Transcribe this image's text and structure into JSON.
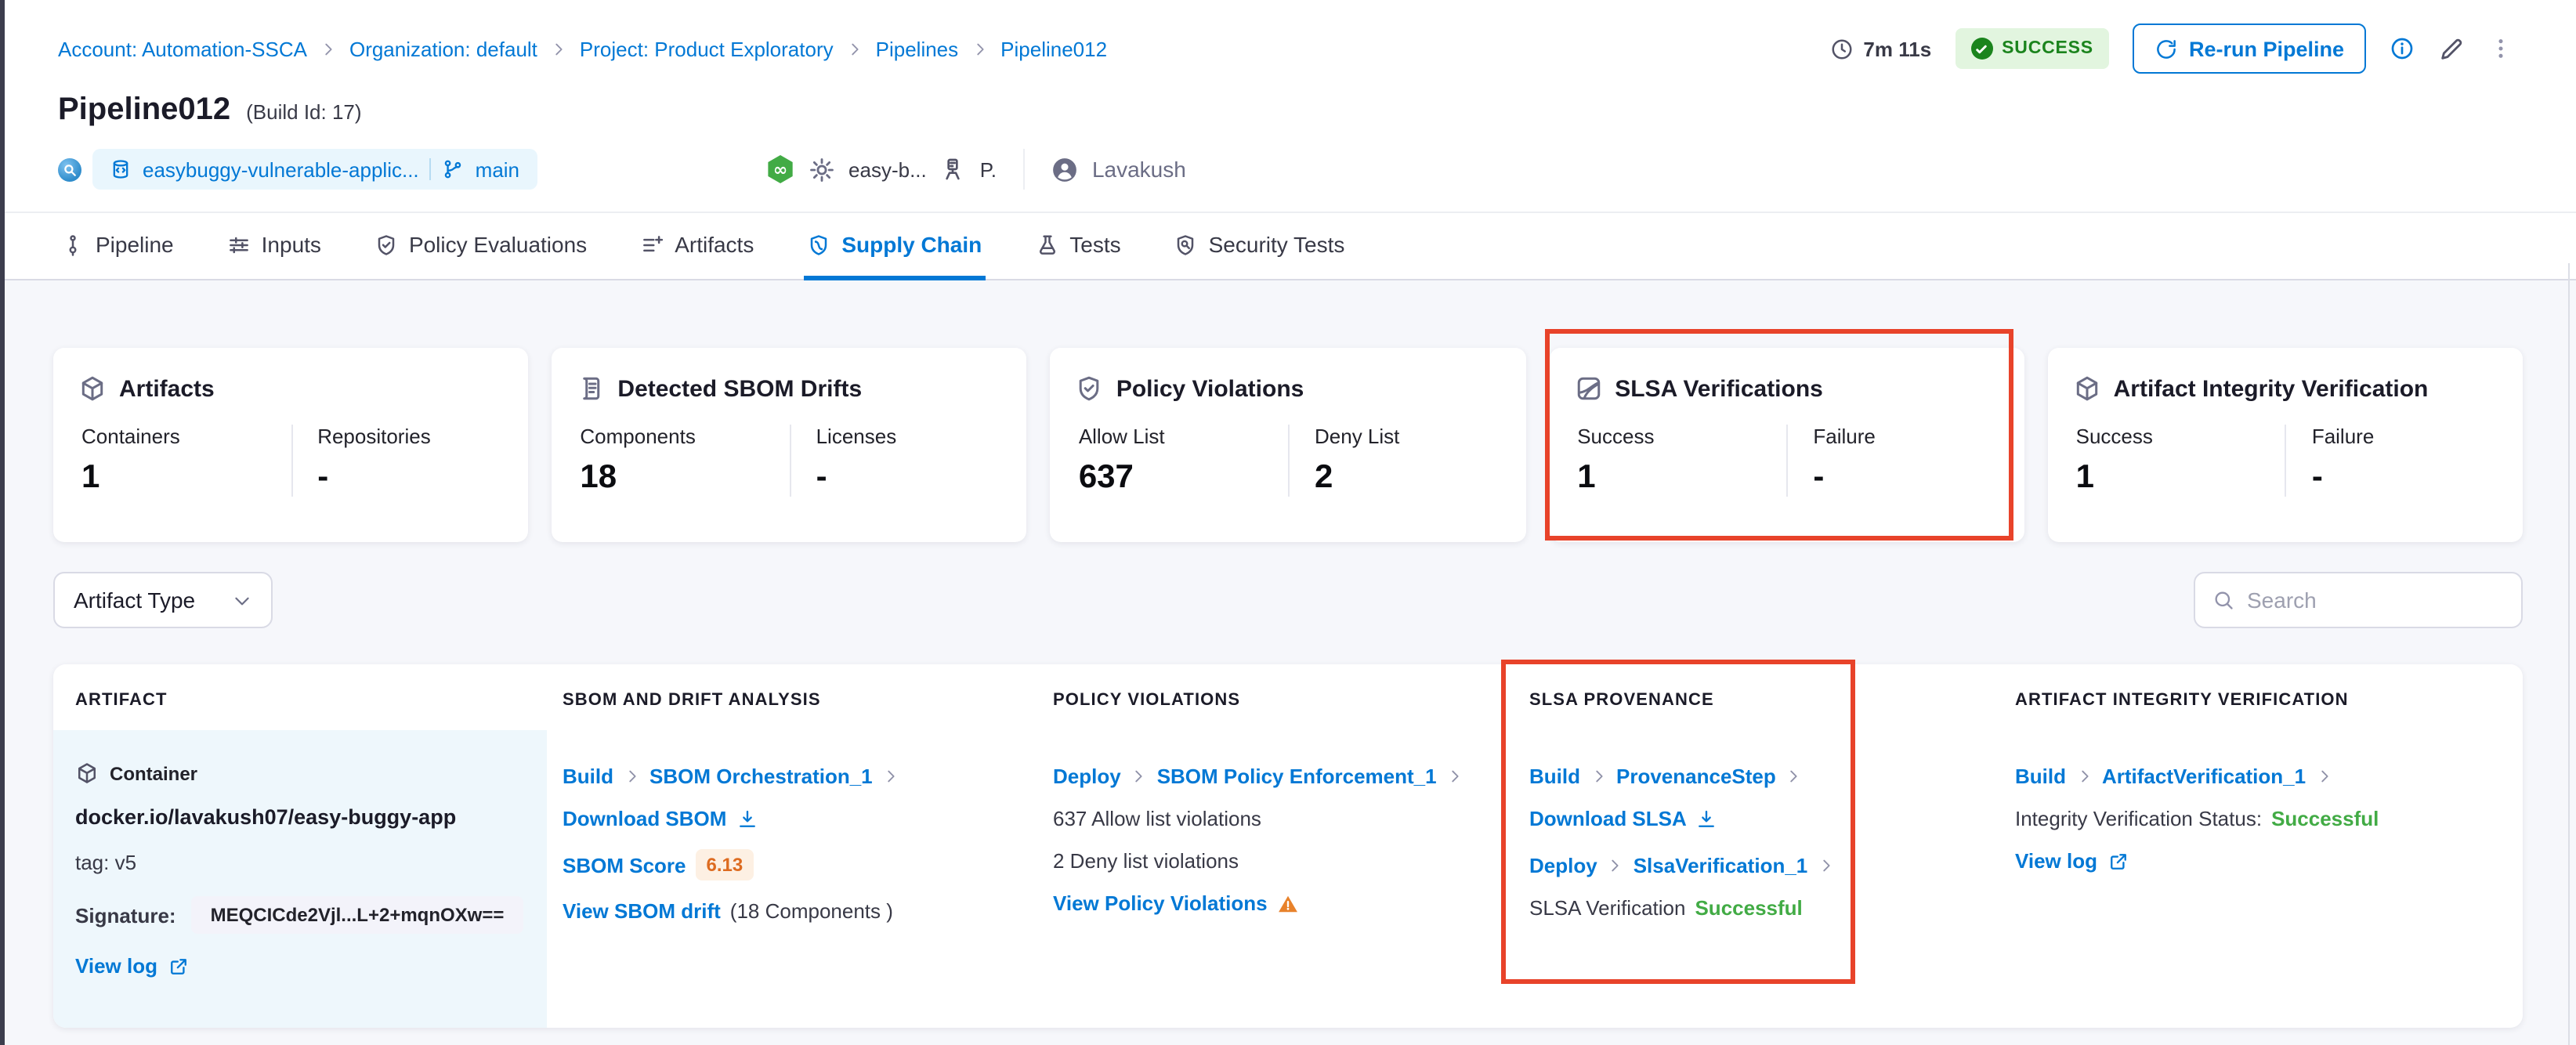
{
  "colors": {
    "accent": "#0278d5",
    "annotation_red": "#e8432a",
    "success_text": "#1b841d",
    "status_green": "#42ab45",
    "score_orange": "#dd6b20"
  },
  "breadcrumb": {
    "items": [
      "Account: Automation-SSCA",
      "Organization: default",
      "Project: Product Exploratory",
      "Pipelines",
      "Pipeline012"
    ]
  },
  "header": {
    "title": "Pipeline012",
    "build_id": "(Build Id: 17)",
    "duration": "7m 11s",
    "status": "SUCCESS",
    "rerun_label": "Re-run Pipeline",
    "repo": "easybuggy-vulnerable-applic...",
    "branch": "main",
    "execution_context": "easy-b...",
    "execution_abbrev": "P.",
    "user": "Lavakush",
    "ci_glyph": "∞"
  },
  "tabs": {
    "items": [
      {
        "label": "Pipeline"
      },
      {
        "label": "Inputs"
      },
      {
        "label": "Policy Evaluations"
      },
      {
        "label": "Artifacts"
      },
      {
        "label": "Supply Chain"
      },
      {
        "label": "Tests"
      },
      {
        "label": "Security Tests"
      }
    ],
    "active": "Supply Chain"
  },
  "cards": [
    {
      "title": "Artifacts",
      "stats": [
        {
          "label": "Containers",
          "value": "1"
        },
        {
          "label": "Repositories",
          "value": "-"
        }
      ]
    },
    {
      "title": "Detected SBOM Drifts",
      "stats": [
        {
          "label": "Components",
          "value": "18"
        },
        {
          "label": "Licenses",
          "value": "-"
        }
      ]
    },
    {
      "title": "Policy Violations",
      "stats": [
        {
          "label": "Allow List",
          "value": "637"
        },
        {
          "label": "Deny List",
          "value": "2"
        }
      ]
    },
    {
      "title": "SLSA Verifications",
      "stats": [
        {
          "label": "Success",
          "value": "1"
        },
        {
          "label": "Failure",
          "value": "-"
        }
      ]
    },
    {
      "title": "Artifact Integrity Verification",
      "stats": [
        {
          "label": "Success",
          "value": "1"
        },
        {
          "label": "Failure",
          "value": "-"
        }
      ]
    }
  ],
  "filters": {
    "artifact_type_label": "Artifact Type",
    "search_placeholder": "Search"
  },
  "table": {
    "headers": [
      "ARTIFACT",
      "SBOM AND DRIFT ANALYSIS",
      "POLICY VIOLATIONS",
      "SLSA PROVENANCE",
      "ARTIFACT INTEGRITY VERIFICATION"
    ],
    "row": {
      "artifact": {
        "type_label": "Container",
        "image": "docker.io/lavakush07/easy-buggy-app",
        "tag": "tag: v5",
        "signature_label": "Signature:",
        "signature_value": "MEQCICde2Vjl...L+2+mqnOXw==",
        "view_log_label": "View log"
      },
      "sbom": {
        "stage": "Build",
        "step": "SBOM Orchestration_1",
        "download_label": "Download SBOM",
        "score_label": "SBOM Score",
        "score_value": "6.13",
        "drift_link": "View SBOM drift",
        "drift_note": "(18 Components )"
      },
      "policy": {
        "stage": "Deploy",
        "step": "SBOM Policy Enforcement_1",
        "allow_text": "637 Allow list violations",
        "deny_text": "2 Deny list violations",
        "view_link": "View Policy Violations"
      },
      "slsa": {
        "stage1": "Build",
        "step1": "ProvenanceStep",
        "download_label": "Download SLSA",
        "stage2": "Deploy",
        "step2": "SlsaVerification_1",
        "status_label": "SLSA Verification",
        "status_value": "Successful"
      },
      "integrity": {
        "stage": "Build",
        "step": "ArtifactVerification_1",
        "status_label": "Integrity Verification Status:",
        "status_value": "Successful",
        "view_log_label": "View log"
      }
    }
  }
}
